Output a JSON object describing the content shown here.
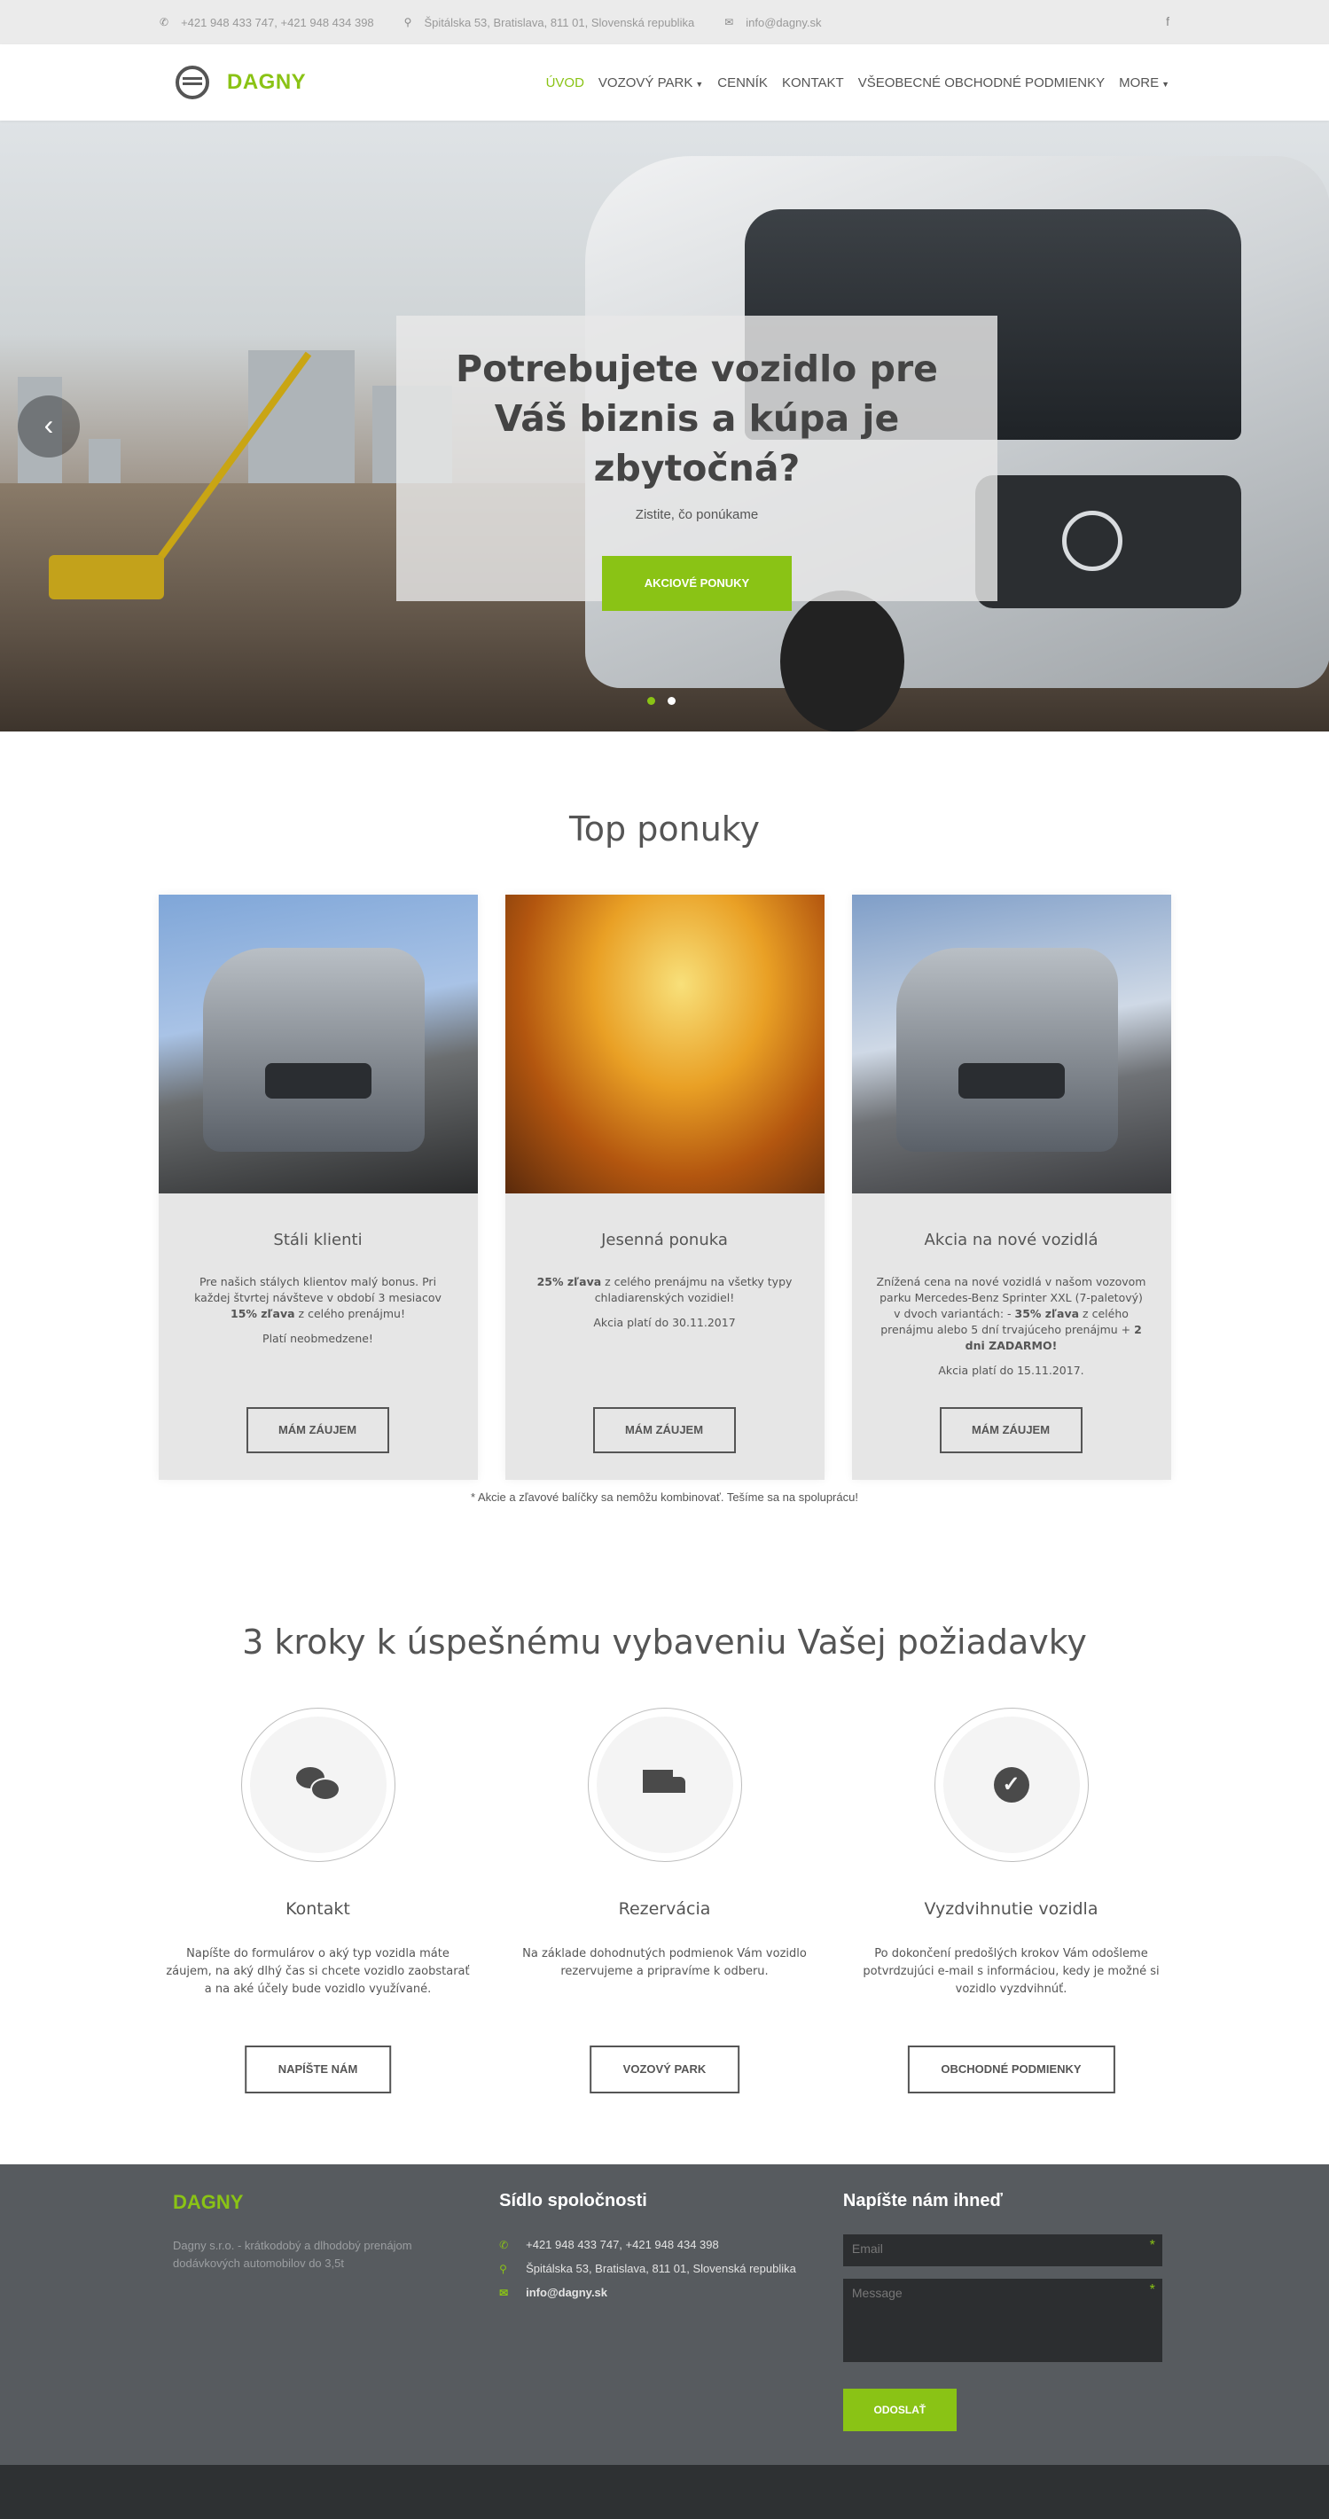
{
  "topbar": {
    "phones": "+421 948 433 747, +421 948 434 398",
    "address": "Špitálska 53, Bratislava, 811 01, Slovenská republika",
    "email": "info@dagny.sk",
    "facebook_icon": "f"
  },
  "nav": {
    "brand": "DAGNY",
    "items": [
      {
        "label": "ÚVOD",
        "active": true
      },
      {
        "label": "VOZOVÝ PARK",
        "dropdown": true
      },
      {
        "label": "CENNÍK"
      },
      {
        "label": "KONTAKT"
      },
      {
        "label": "VŠEOBECNÉ OBCHODNÉ PODMIENKY"
      },
      {
        "label": "MORE",
        "dropdown": true
      }
    ]
  },
  "hero": {
    "title": "Potrebujete vozidlo pre Váš biznis a kúpa je zbytočná?",
    "subtitle": "Zistite, čo ponúkame",
    "cta": "AKCIOVÉ PONUKY",
    "prev_icon": "‹"
  },
  "offers": {
    "title": "Top ponuky",
    "cards": [
      {
        "title": "Stáli klienti",
        "text1_pre": "Pre našich stálych klientov malý bonus. Pri každej štvrtej návšteve v období 3 mesiacov ",
        "text1_bold": "15% zľava",
        "text1_post": " z celého prenájmu!",
        "text2": "Platí neobmedzene!",
        "button": "MÁM ZÁUJEM"
      },
      {
        "title": "Jesenná ponuka",
        "text1_bold": "25% zľava",
        "text1_post": " z celého prenájmu na všetky typy chladiarenských vozidiel!",
        "text2": "Akcia platí do 30.11.2017",
        "button": "MÁM ZÁUJEM"
      },
      {
        "title": "Akcia na nové vozidlá",
        "text1_pre": "Znížená cena na nové vozidlá v našom vozovom parku Mercedes-Benz Sprinter XXL (7-paletový) v dvoch variantách: - ",
        "text1_bold": "35% zľava",
        "text1_mid": " z celého prenájmu alebo 5 dní trvajúceho prenájmu + ",
        "text1_bold2": "2 dni ZADARMO!",
        "text2": "Akcia platí do 15.11.2017.",
        "button": "MÁM ZÁUJEM"
      }
    ],
    "note": "* Akcie a zľavové balíčky sa nemôžu kombinovať. Tešíme sa na spoluprácu!"
  },
  "steps": {
    "title": "3 kroky k úspešnému vybaveniu Vašej požiadavky",
    "items": [
      {
        "icon": "chat-icon",
        "title": "Kontakt",
        "text": "Napíšte do formulárov o aký typ vozidla máte záujem, na aký dlhý čas si chcete vozidlo zaobstarať a na aké účely bude vozidlo využívané.",
        "button": "NAPÍŠTE NÁM"
      },
      {
        "icon": "truck-icon",
        "title": "Rezervácia",
        "text": "Na základe dohodnutých podmienok Vám vozidlo rezervujeme a pripravíme k odberu.",
        "button": "VOZOVÝ PARK"
      },
      {
        "icon": "check-circle-icon",
        "title": "Vyzdvihnutie vozidla",
        "text": "Po dokončení predošlých krokov Vám odošleme potvrdzujúci e-mail s informáciou, kedy je možné si vozidlo vyzdvihnúť.",
        "button": "OBCHODNÉ PODMIENKY"
      }
    ]
  },
  "footer": {
    "brand": "DAGNY",
    "desc": "Dagny s.r.o. - krátkodobý a dlhodobý prenájom dodávkových automobilov do 3,5t",
    "hq_title": "Sídlo spoločnosti",
    "phones": "+421 948 433 747, +421 948 434 398",
    "address": "Špitálska 53, Bratislava, 811 01, Slovenská republika",
    "email": "info@dagny.sk",
    "form_title": "Napíšte nám ihneď",
    "email_placeholder": "Email",
    "message_placeholder": "Message",
    "required_mark": "*",
    "send": "ODOSLAŤ"
  },
  "colors": {
    "accent": "#8ac315",
    "footer_bg": "#575b5f",
    "bottom_bar": "#2e3133"
  }
}
